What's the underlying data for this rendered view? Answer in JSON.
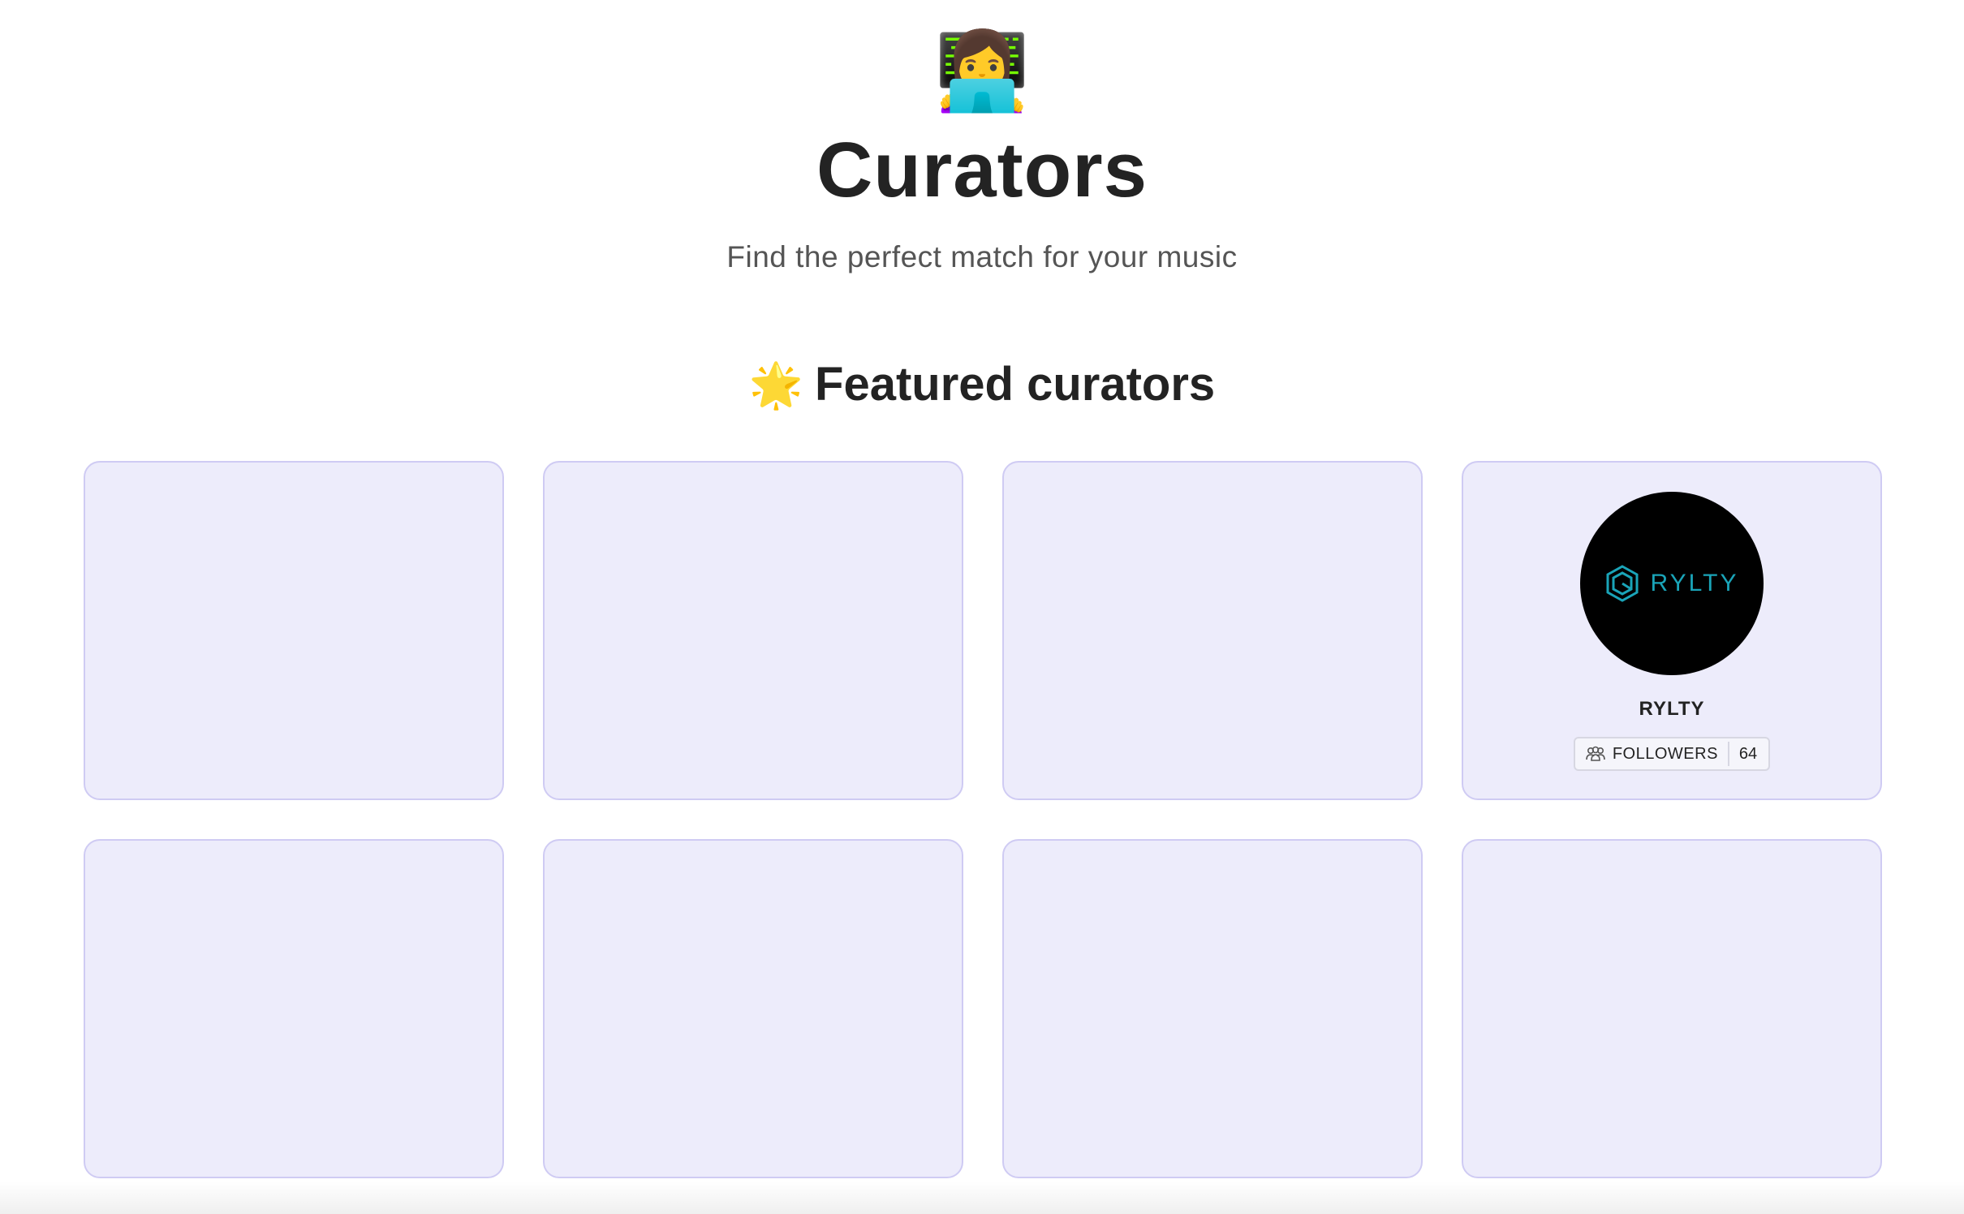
{
  "hero": {
    "emoji": "👩‍💻",
    "title": "Curators",
    "subtitle": "Find the perfect match for your music"
  },
  "featured": {
    "emoji": "🌟",
    "title": "Featured curators",
    "cards": [
      {
        "name": "",
        "logo_text": "",
        "followers_label": "",
        "followers_count": ""
      },
      {
        "name": "",
        "logo_text": "",
        "followers_label": "",
        "followers_count": ""
      },
      {
        "name": "",
        "logo_text": "",
        "followers_label": "",
        "followers_count": ""
      },
      {
        "name": "RYLTY",
        "logo_text": "RYLTY",
        "followers_label": "FOLLOWERS",
        "followers_count": "64"
      },
      {
        "name": "",
        "logo_text": "",
        "followers_label": "",
        "followers_count": ""
      },
      {
        "name": "",
        "logo_text": "",
        "followers_label": "",
        "followers_count": ""
      },
      {
        "name": "",
        "logo_text": "",
        "followers_label": "",
        "followers_count": ""
      },
      {
        "name": "",
        "logo_text": "",
        "followers_label": "",
        "followers_count": ""
      }
    ]
  },
  "colors": {
    "card_bg": "#edecfb",
    "card_border": "#cfcbf3",
    "logo_accent": "#1aa4b8"
  },
  "icons": {
    "followers": "people-icon"
  }
}
